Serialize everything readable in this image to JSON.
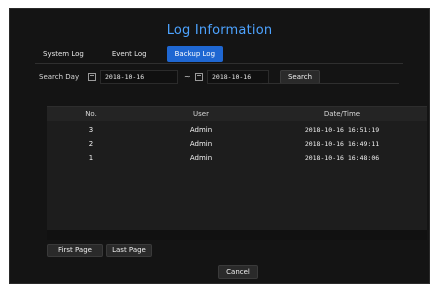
{
  "dialog": {
    "title": "Log Information"
  },
  "tabs": [
    {
      "label": "System Log",
      "active": false
    },
    {
      "label": "Event Log",
      "active": false
    },
    {
      "label": "Backup Log",
      "active": true
    }
  ],
  "search": {
    "label": "Search Day",
    "from_date": "2018-10-16",
    "to_date": "2018-10-16",
    "separator": "~",
    "button_label": "Search"
  },
  "table": {
    "headers": {
      "no": "No.",
      "user": "User",
      "date_time": "Date/Time"
    },
    "rows": [
      {
        "no": "3",
        "user": "Admin",
        "date_time": "2018-10-16 16:51:19"
      },
      {
        "no": "2",
        "user": "Admin",
        "date_time": "2018-10-16 16:49:11"
      },
      {
        "no": "1",
        "user": "Admin",
        "date_time": "2018-10-16 16:48:06"
      }
    ]
  },
  "pagination": {
    "first_label": "First Page",
    "last_label": "Last Page"
  },
  "footer": {
    "cancel_label": "Cancel"
  },
  "colors": {
    "title": "#4da3ff",
    "active_tab": "#1f67d2",
    "background": "#141414"
  }
}
